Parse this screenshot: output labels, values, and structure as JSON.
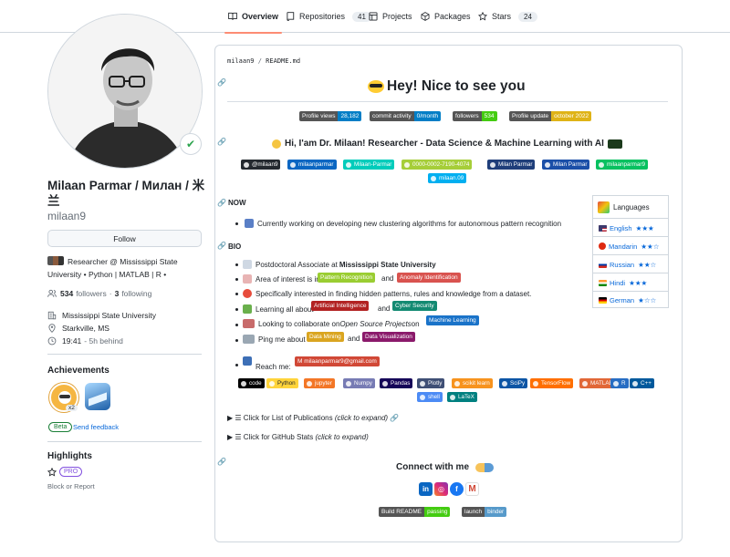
{
  "nav": {
    "tabs": [
      {
        "label": "Overview",
        "icon": "book-icon"
      },
      {
        "label": "Repositories",
        "count": "41",
        "icon": "repo-icon"
      },
      {
        "label": "Projects",
        "icon": "table-icon"
      },
      {
        "label": "Packages",
        "icon": "package-icon"
      },
      {
        "label": "Stars",
        "count": "24",
        "icon": "star-icon"
      }
    ]
  },
  "profile": {
    "name": "Milaan Parmar / Милан / 米兰",
    "login": "milaan9",
    "follow_label": "Follow",
    "bio": "Researcher @ Mississippi State University • Python | MATLAB | R •",
    "followers_count": "534",
    "followers_label": "followers",
    "following_count": "3",
    "following_label": "following",
    "org": "Mississippi State University",
    "location": "Starkville, MS",
    "time": "19:41",
    "time_note": "- 5h behind",
    "achievements_title": "Achievements",
    "achievement_count": "x2",
    "beta_label": "Beta",
    "feedback_label": "Send feedback",
    "highlights_title": "Highlights",
    "pro_label": "PRO",
    "block_label": "Block or Report"
  },
  "readme": {
    "path_user": "milaan9",
    "path_sep": "/",
    "path_file": "README.md",
    "title": "Hey! Nice to see you",
    "stats_badges": [
      {
        "l": "Profile views",
        "r": "28,182",
        "rc": "#007ec6"
      },
      {
        "l": "commit activity",
        "r": "0/month",
        "rc": "#007ec6"
      },
      {
        "l": "followers",
        "r": "534",
        "rc": "#4c1"
      },
      {
        "l": "Profile update",
        "r": "october 2022",
        "rc": "#dfb317"
      }
    ],
    "intro": "Hi, I'am Dr. Milaan! Researcher - Data Science & Machine Learning with AI",
    "social_badges": [
      {
        "t": "@milaan9",
        "c": "#24292f"
      },
      {
        "t": "milaanparmar",
        "c": "#0a66c2"
      },
      {
        "t": "Milaan-Parmar",
        "c": "#00ccbb"
      },
      {
        "t": "0000-0002-7190-4074",
        "c": "#a6ce39"
      },
      {
        "t": "Milan Parmar",
        "c": "#1f3e7a"
      },
      {
        "t": "Milan Parmar",
        "c": "#1b4fa8"
      },
      {
        "t": "milaanparmar9",
        "c": "#07c160"
      },
      {
        "t": "milaan.09",
        "c": "#00aff0"
      }
    ],
    "now_title": "NOW",
    "now_item": "Currently working on developing new clustering algorithms for autonomous pattern recognition",
    "bio_title": "BIO",
    "bio_pos_pre": "Postdoctoral Associate at ",
    "bio_pos_strong": "Mississippi State University",
    "bio_interest_pre": "Area of interest is in",
    "bio_interest_and": "and",
    "tag_pattern": "Pattern Recognition",
    "tag_anomaly": "Anomaly Identification",
    "bio_specific": "Specifically interested in finding hidden patterns, rules and knowledge from a dataset.",
    "bio_learning_pre": "Learning all about",
    "bio_learning_and": "and",
    "tag_ai": "Artificial Intelligence",
    "tag_cyber": "Cyber Security",
    "bio_collab_pre": "Looking to collaborate on ",
    "bio_collab_em": "Open Source Projects",
    "bio_collab_on": " on",
    "tag_ml": "Machine Learning",
    "bio_ping_pre": "Ping me about",
    "bio_ping_and": "and",
    "tag_dm": "Data Mining",
    "tag_dv": "Data Visualization",
    "reach_label": "Reach me:",
    "reach_email": "milaanparmar9@gmail.com",
    "tech_badges": [
      {
        "t": "code",
        "c": "#000000"
      },
      {
        "t": "Python",
        "c": "#ffd43b",
        "fg": "#1f2328"
      },
      {
        "t": "jupyter",
        "c": "#f37626"
      },
      {
        "t": "Numpy",
        "c": "#777bb4"
      },
      {
        "t": "Pandas",
        "c": "#150458"
      },
      {
        "t": "Plotly",
        "c": "#3f4f75"
      },
      {
        "t": "scikit learn",
        "c": "#f7931e"
      },
      {
        "t": "SciPy",
        "c": "#0c55a5"
      },
      {
        "t": "TensorFlow",
        "c": "#ff6f00"
      },
      {
        "t": "MATLAB",
        "c": "#e16737"
      },
      {
        "t": "R",
        "c": "#276dc3"
      },
      {
        "t": "C++",
        "c": "#00599c"
      },
      {
        "t": "shell",
        "c": "#4c8bf5"
      },
      {
        "t": "LaTeX",
        "c": "#008080"
      }
    ],
    "pubs_summary": "Click for List of Publications",
    "pubs_em": "(click to expand)",
    "stats_summary": "Click for GitHub Stats",
    "stats_em": "(click to expand)",
    "connect_title": "Connect with me",
    "build_badges": [
      {
        "l": "Build README",
        "r": "passing",
        "rc": "#4c1"
      },
      {
        "l": "launch",
        "r": "binder",
        "rc": "#579aca"
      }
    ]
  },
  "languages": {
    "title": "Languages",
    "items": [
      {
        "name": "English",
        "stars": "★★★"
      },
      {
        "name": "Mandarin",
        "stars": "★★☆"
      },
      {
        "name": "Russian",
        "stars": "★★☆"
      },
      {
        "name": "Hindi",
        "stars": "★★★"
      },
      {
        "name": "German",
        "stars": "★☆☆"
      }
    ]
  },
  "colors": {
    "link": "#0969da",
    "tab_underline": "#fd8c73",
    "border": "#d0d7de",
    "muted": "#656d76"
  }
}
